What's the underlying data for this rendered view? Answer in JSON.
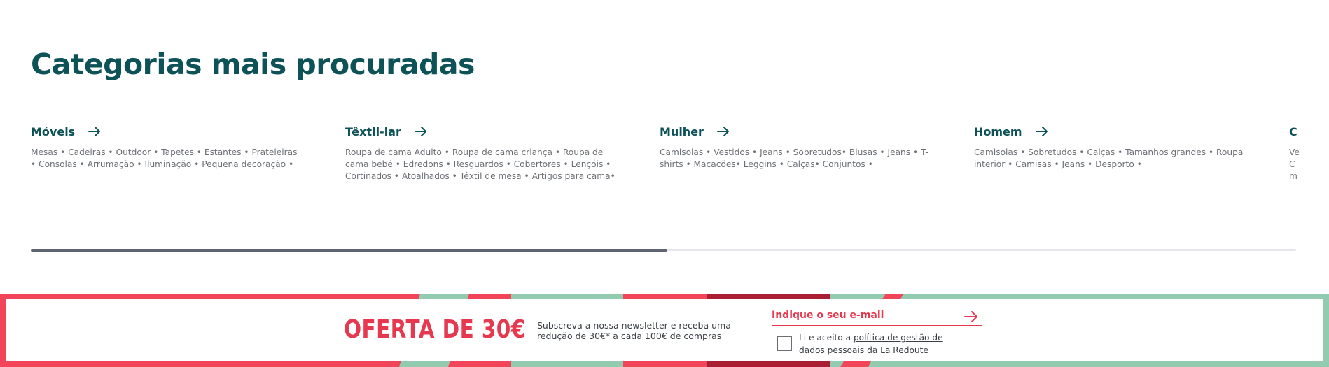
{
  "section": {
    "title": "Categorias mais procuradas"
  },
  "categories": [
    {
      "name": "Móveis",
      "items": "Mesas • Cadeiras • Outdoor • Tapetes • Estantes • Prateleiras • Consolas • Arrumação • Iluminação • Pequena decoração •"
    },
    {
      "name": "Têxtil-lar",
      "items": "Roupa de cama Adulto • Roupa de cama criança • Roupa de cama bebé • Edredons • Resguardos • Cobertores • Lençóis • Cortinados • Atoalhados • Têxtil de mesa • Artigos para cama•"
    },
    {
      "name": "Mulher",
      "items": "Camisolas • Vestidos • Jeans • Sobretudos• Blusas • Jeans • T-shirts • Macacões• Leggins • Calças• Conjuntos •"
    },
    {
      "name": "Homem",
      "items": "Camisolas • Sobretudos • Calças • Tamanhos grandes • Roupa interior • Camisas • Jeans • Desporto •"
    },
    {
      "name": "C",
      "items": "Ve\nC\nm"
    }
  ],
  "carousel": {
    "progress_percent": 50.3
  },
  "newsletter": {
    "offer": "OFERTA DE 30€",
    "description": "Subscreva a nossa newsletter e receba uma redução de 30€* a cada 100€ de compras",
    "email_placeholder": "Indique o seu e-mail",
    "consent_prefix": "Li e aceito a ",
    "consent_link": "política de gestão de dados pessoais",
    "consent_suffix": " da La Redoute"
  },
  "colors": {
    "primary": "#0d5257",
    "accent": "#e6384f",
    "banner_green": "#93cbb0",
    "banner_dark_red": "#a91e32"
  },
  "icons": {
    "category_arrow": "arrow-right-icon",
    "submit": "arrow-right-icon"
  }
}
